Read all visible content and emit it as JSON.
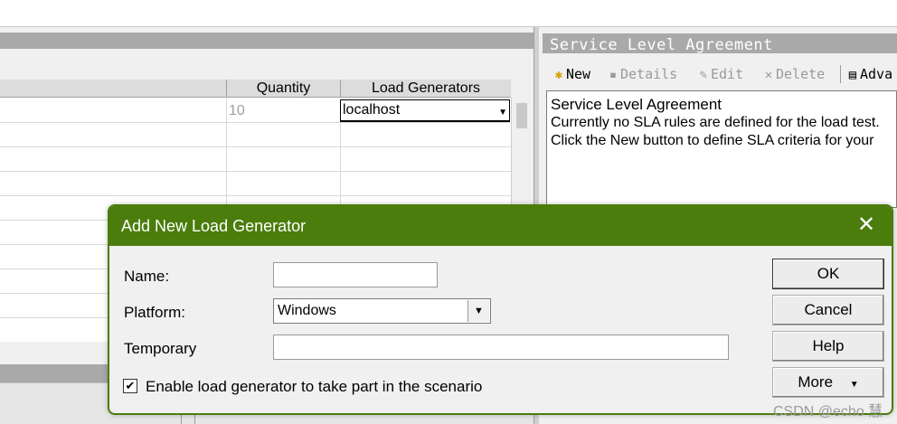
{
  "grid": {
    "columns": [
      "Quantity",
      "Load Generators"
    ],
    "first_row": {
      "quantity": "10",
      "load_generator": "localhost"
    }
  },
  "sla": {
    "title": "Service Level Agreement",
    "toolbar": {
      "new": "New",
      "details": "Details",
      "edit": "Edit",
      "delete": "Delete",
      "advanced": "Adva"
    },
    "content": {
      "heading": "Service Level Agreement",
      "line1": "Currently no SLA rules are defined for the load test.",
      "line2": "Click the New button to define SLA criteria for your"
    }
  },
  "dialog": {
    "title": "Add New Load Generator",
    "name_label": "Name:",
    "name_value": "",
    "platform_label": "Platform:",
    "platform_value": "Windows",
    "temporary_label": "Temporary",
    "temporary_value": "",
    "enable_label": "Enable load generator to take part in the scenario",
    "enable_checked": true,
    "buttons": {
      "ok": "OK",
      "cancel": "Cancel",
      "help": "Help",
      "more": "More"
    }
  },
  "watermark": "CSDN @echo 慧",
  "colors": {
    "dialog_accent": "#4a7d0c",
    "panel_header": "#a9a9a9"
  }
}
